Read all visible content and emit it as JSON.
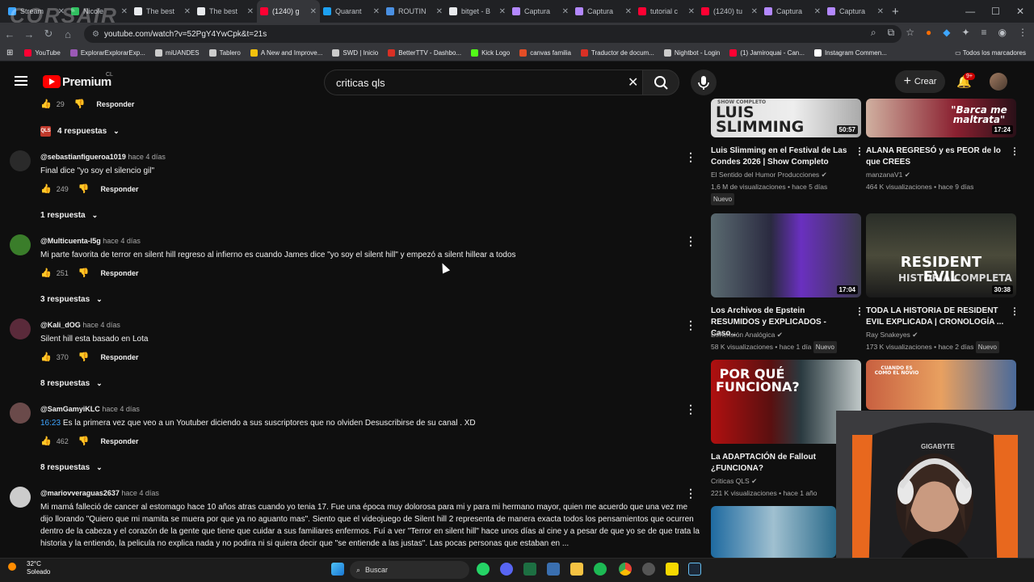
{
  "browser": {
    "tabs": [
      {
        "label": "Stream",
        "color": "#3aa3ff"
      },
      {
        "label": "Nicole",
        "color": "#30c060"
      },
      {
        "label": "The best",
        "color": "#e8eaed"
      },
      {
        "label": "The best",
        "color": "#e8eaed"
      },
      {
        "label": "(1240) g",
        "color": "#ff0033"
      },
      {
        "label": "Quarant",
        "color": "#1da1f2"
      },
      {
        "label": "ROUTIN",
        "color": "#4a90e2"
      },
      {
        "label": "bitget - B",
        "color": "#e8eaed"
      },
      {
        "label": "Captura",
        "color": "#b388ff"
      },
      {
        "label": "Captura",
        "color": "#b388ff"
      },
      {
        "label": "tutorial c",
        "color": "#ff0033"
      },
      {
        "label": "(1240) tu",
        "color": "#ff0033"
      },
      {
        "label": "Captura",
        "color": "#b388ff"
      },
      {
        "label": "Captura",
        "color": "#b388ff"
      }
    ],
    "url": "youtube.com/watch?v=52PgY4YwCpk&t=21s",
    "bookmarks": [
      {
        "label": "YouTube",
        "color": "#ff0033"
      },
      {
        "label": "ExplorarExplorarExp...",
        "color": "#9b59b6"
      },
      {
        "label": "miUANDES",
        "color": "#cccccc"
      },
      {
        "label": "Tablero",
        "color": "#cccccc"
      },
      {
        "label": "A New and Improve...",
        "color": "#f4c20d"
      },
      {
        "label": "SWD | Inicio",
        "color": "#cccccc"
      },
      {
        "label": "BetterTTV - Dashbo...",
        "color": "#d93025"
      },
      {
        "label": "Kick Logo",
        "color": "#53fc18"
      },
      {
        "label": "canvas familia",
        "color": "#e44d26"
      },
      {
        "label": "Traductor de docum...",
        "color": "#d93025"
      },
      {
        "label": "Nightbot - Login",
        "color": "#cccccc"
      },
      {
        "label": "(1) Jamiroquai - Can...",
        "color": "#ff0033"
      },
      {
        "label": "Instagram Commen...",
        "color": "#ffffff"
      }
    ],
    "bookmarks_all": "Todos los marcadores",
    "overlay_brand": "CORSAIR"
  },
  "youtube": {
    "brand": "Premium",
    "country": "CL",
    "search_value": "criticas qls",
    "create_label": "Crear",
    "notif_count": "9+"
  },
  "comments": {
    "top_likes": "29",
    "reply_label": "Responder",
    "first_replies": "4 respuestas",
    "items": [
      {
        "author": "@sebastianfigueroa1019",
        "time": "hace 4 días",
        "text": "Final dice \"yo soy el silencio gil\"",
        "likes": "249",
        "replies": "1 respuesta",
        "avatar": "#2a2a2a"
      },
      {
        "author": "@Multicuenta-l5g",
        "time": "hace 4 días",
        "text": "Mi parte favorita de terror en silent hill regreso al infierno es cuando James dice \"yo soy el silent hill\"  y empezó a silent hillear a todos",
        "likes": "251",
        "replies": "3 respuestas",
        "avatar": "#3a7d2a"
      },
      {
        "author": "@Kali_dOG",
        "time": "hace 4 días",
        "text": "Silent hill esta basado en Lota",
        "likes": "370",
        "replies": "8 respuestas",
        "avatar": "#5a2a3a"
      },
      {
        "author": "@SamGamyiKLC",
        "time": "hace 4 días",
        "ts": "16:23",
        "text": "Es la primera vez que veo a un Youtuber diciendo a sus suscriptores que no olviden Desuscribirse de su canal . XD",
        "likes": "462",
        "replies": "8 respuestas",
        "avatar": "#6a4a4a"
      },
      {
        "author": "@mariovveraguas2637",
        "time": "hace 4 días",
        "text": "Mi mamá falleció de cancer al estomago hace 10 años atras cuando yo tenia 17. Fue una época muy dolorosa para mi y para mi hermano mayor, quien me acuerdo que una vez me dijo llorando \"Quiero que mi mamita se muera por que ya no aguanto mas\". Siento que el videojuego de Silent hill 2 representa de manera exacta todos los pensamientos que ocurren dentro de la cabeza y el corazón de la gente que tiene que cuidar a sus familiares enfermos. Fuí a ver \"Terror en silent hill\" hace unos días al cine y a pesar de que yo se de que trata la historia y la entiendo, la pelicula no explica nada y no podira ni si quiera decir que \"se entiende a las justas\". Las pocas personas que estaban en ...",
        "avatar": "#cccccc"
      }
    ]
  },
  "videos": [
    {
      "title": "Luis Slimming en el Festival de Las Condes 2026 | Show Completo",
      "channel": "El Sentido del Humor Producciones",
      "meta": "1,6 M de visualizaciones • hace 5 días",
      "badge": "Nuevo",
      "duration": "50:57",
      "thumb_text": "LUIS SLIMMING",
      "thumb_small": "SHOW COMPLETO"
    },
    {
      "title": "ALANA REGRESÓ y es PEOR de lo que CREES",
      "channel": "manzanaV1",
      "meta": "464 K visualizaciones • hace 9 días",
      "duration": "17:24",
      "thumb_text": "\"Barca me maltrata\""
    },
    {
      "title": "Los Archivos de Epstein RESUMIDOS y EXPLICADOS - Caso...",
      "channel": "Dimensión Analógica",
      "meta": "58 K visualizaciones • hace 1 día",
      "badge": "Nuevo",
      "duration": "17:04"
    },
    {
      "title": "TODA LA HISTORIA DE RESIDENT EVIL EXPLICADA | CRONOLOGÍA ...",
      "channel": "Ray Snakeyes",
      "meta": "173 K visualizaciones • hace 2 días",
      "badge": "Nuevo",
      "duration": "30:38",
      "thumb_text": "RESIDENT EVIL",
      "thumb_small": "HISTORIA COMPLETA"
    },
    {
      "title": "La ADAPTACIÓN de Fallout ¿FUNCIONA?",
      "channel": "Criticas QLS",
      "meta": "221 K visualizaciones • hace 1 año",
      "thumb_text": "POR QUÉ FUNCIONA?"
    },
    {
      "title": "",
      "thumb_text": "CUANDO ES COMO EL NOVIO"
    }
  ],
  "taskbar": {
    "temp": "32°C",
    "weather": "Soleado",
    "search_label": "Buscar"
  },
  "webcam": {
    "chair_brand": "GIGABYTE"
  }
}
